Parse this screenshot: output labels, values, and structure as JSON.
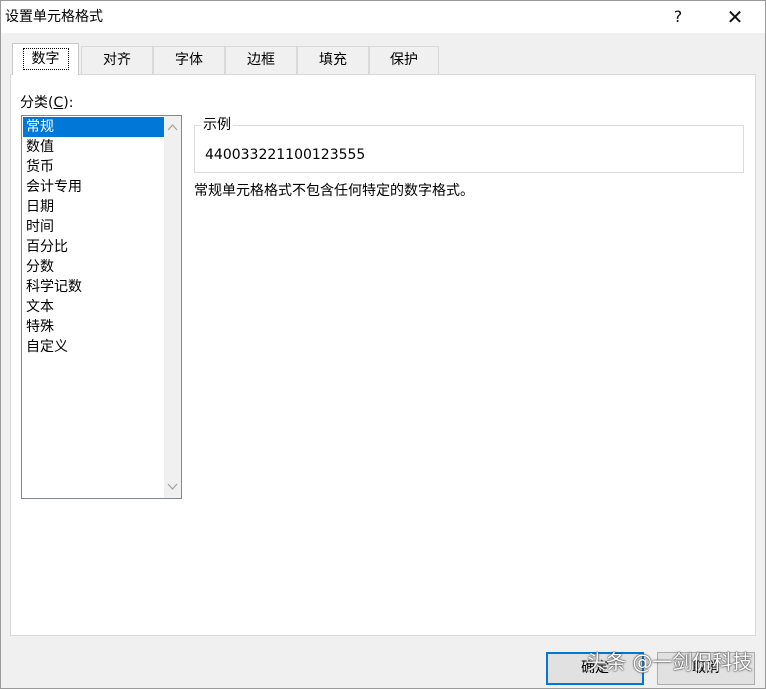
{
  "window": {
    "title": "设置单元格格式",
    "help_glyph": "?",
    "close_glyph": "✕"
  },
  "tabs": [
    {
      "label": "数字",
      "active": true
    },
    {
      "label": "对齐",
      "active": false
    },
    {
      "label": "字体",
      "active": false
    },
    {
      "label": "边框",
      "active": false
    },
    {
      "label": "填充",
      "active": false
    },
    {
      "label": "保护",
      "active": false
    }
  ],
  "category": {
    "label_prefix": "分类(",
    "label_accel": "C",
    "label_suffix": "):",
    "items": [
      {
        "label": "常规",
        "selected": true
      },
      {
        "label": "数值",
        "selected": false
      },
      {
        "label": "货币",
        "selected": false
      },
      {
        "label": "会计专用",
        "selected": false
      },
      {
        "label": "日期",
        "selected": false
      },
      {
        "label": "时间",
        "selected": false
      },
      {
        "label": "百分比",
        "selected": false
      },
      {
        "label": "分数",
        "selected": false
      },
      {
        "label": "科学记数",
        "selected": false
      },
      {
        "label": "文本",
        "selected": false
      },
      {
        "label": "特殊",
        "selected": false
      },
      {
        "label": "自定义",
        "selected": false
      }
    ]
  },
  "sample": {
    "legend": "示例",
    "value": "440033221100123555"
  },
  "description": "常规单元格格式不包含任何特定的数字格式。",
  "buttons": {
    "ok": "确定",
    "cancel": "取消"
  },
  "watermark": "头条 @一剑侃科技",
  "icons": {
    "scroll_up": "chevron-up-icon",
    "scroll_down": "chevron-down-icon"
  },
  "colors": {
    "selection": "#0078d7",
    "dialog_bg": "#f0f0f0"
  }
}
